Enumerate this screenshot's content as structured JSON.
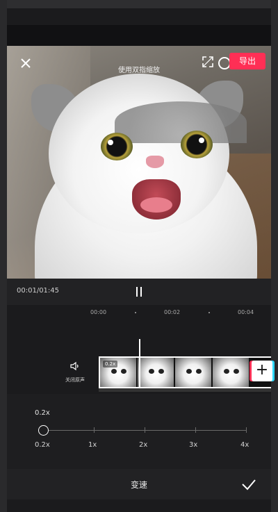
{
  "preview": {
    "hint": "使用双指缩放",
    "export_label": "导出"
  },
  "player": {
    "time": "00:01/01:45"
  },
  "timeline": {
    "ticks": [
      "00:00",
      "00:02",
      "00:04"
    ]
  },
  "track": {
    "mute_label": "关闭原声",
    "clip_speed_badge": "0.2x",
    "add_label": "+"
  },
  "speed": {
    "current_value": "0.2x",
    "current_fraction": 0,
    "marks": [
      "0.2x",
      "1x",
      "2x",
      "3x",
      "4x"
    ],
    "panel_title": "变速"
  },
  "colors": {
    "accent": "#ff2f55",
    "background": "#1b1b1d"
  }
}
